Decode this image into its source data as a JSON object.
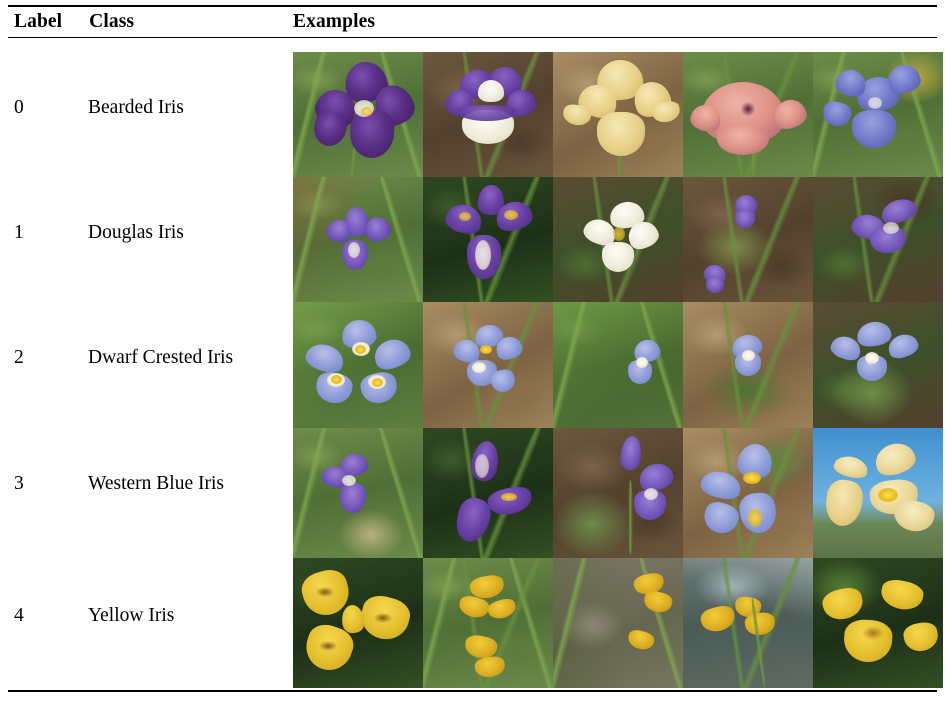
{
  "table": {
    "headers": {
      "label": "Label",
      "class": "Class",
      "examples": "Examples"
    },
    "rows": [
      {
        "index": "0",
        "class_name": "Bearded Iris",
        "examples": [
          {
            "alt": "dark purple bearded iris in garden bed"
          },
          {
            "alt": "purple and white bearded iris on bare soil"
          },
          {
            "alt": "cream peach bearded iris"
          },
          {
            "alt": "pink ruffled bearded iris"
          },
          {
            "alt": "blue violet bearded irises in flower border"
          }
        ]
      },
      {
        "index": "1",
        "class_name": "Douglas Iris",
        "examples": [
          {
            "alt": "purple douglas iris among grass"
          },
          {
            "alt": "cluster of purple douglas iris blooms"
          },
          {
            "alt": "white cream douglas iris beside ferns"
          },
          {
            "alt": "pale douglas iris on open ground"
          },
          {
            "alt": "violet douglas iris in leaf litter"
          }
        ]
      },
      {
        "index": "2",
        "class_name": "Dwarf Crested Iris",
        "examples": [
          {
            "alt": "periwinkle dwarf crested iris with yellow crest"
          },
          {
            "alt": "dwarf crested iris on brown leaf litter"
          },
          {
            "alt": "dwarf crested iris among green blades"
          },
          {
            "alt": "dwarf crested iris on forest floor"
          },
          {
            "alt": "pale blue dwarf crested iris"
          }
        ]
      },
      {
        "index": "3",
        "class_name": "Western Blue Iris",
        "examples": [
          {
            "alt": "western blue iris in meadow grass"
          },
          {
            "alt": "veined purple western blue iris"
          },
          {
            "alt": "purple western blue iris buds"
          },
          {
            "alt": "lavender western blue iris with yellow signal"
          },
          {
            "alt": "cream yellow iris against blue sky"
          }
        ]
      },
      {
        "index": "4",
        "class_name": "Yellow Iris",
        "examples": [
          {
            "alt": "yellow flag iris close up on dark foliage"
          },
          {
            "alt": "yellow flag irises in tall grass"
          },
          {
            "alt": "yellow flag iris beside grey rock"
          },
          {
            "alt": "yellow flag iris at pond water edge"
          },
          {
            "alt": "yellow flag iris bloom with green leaves"
          }
        ]
      }
    ]
  }
}
